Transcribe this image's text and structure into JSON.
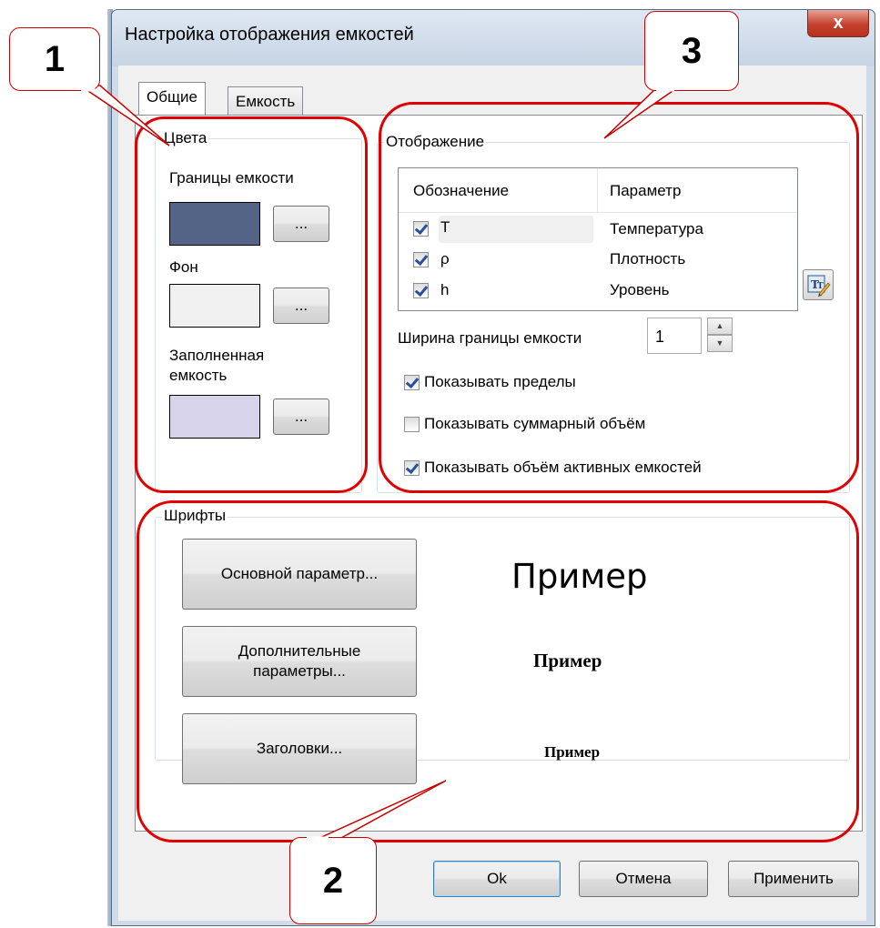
{
  "window": {
    "title": "Настройка отображения емкостей",
    "close_glyph": "x"
  },
  "tabs": [
    {
      "label": "Общие",
      "active": true
    },
    {
      "label": "Емкость",
      "active": false
    }
  ],
  "colors_group": {
    "title": "Цвета",
    "items": [
      {
        "label": "Границы емкости",
        "color": "#536486",
        "button": "..."
      },
      {
        "label": "Фон",
        "color": "#f0f0f0",
        "button": "..."
      },
      {
        "label": "Заполненная емкость",
        "color": "#d7d3ea",
        "button": "..."
      }
    ]
  },
  "display_group": {
    "title": "Отображение",
    "columns": [
      "Обозначение",
      "Параметр"
    ],
    "rows": [
      {
        "symbol": "T",
        "param": "Температура",
        "checked": true
      },
      {
        "symbol": "ρ",
        "param": "Плотность",
        "checked": true
      },
      {
        "symbol": "h",
        "param": "Уровень",
        "checked": true
      }
    ],
    "border_width_label": "Ширина границы емкости",
    "border_width_value": "1",
    "checkboxes": [
      {
        "label": "Показывать пределы",
        "checked": true
      },
      {
        "label": "Показывать суммарный объём",
        "checked": false
      },
      {
        "label": "Показывать объём активных емкостей",
        "checked": true
      }
    ]
  },
  "fonts_group": {
    "title": "Шрифты",
    "buttons": [
      {
        "label": "Основной параметр...",
        "sample": "Пример"
      },
      {
        "label": "Дополнительные параметры...",
        "sample": "Пример"
      },
      {
        "label": "Заголовки...",
        "sample": "Пример"
      }
    ]
  },
  "footer": {
    "ok": "Ok",
    "cancel": "Отмена",
    "apply": "Применить"
  },
  "callouts": [
    "1",
    "2",
    "3"
  ],
  "accent_colors": {
    "annotation": "#e00000",
    "window_frame": "#cfdbe8"
  }
}
